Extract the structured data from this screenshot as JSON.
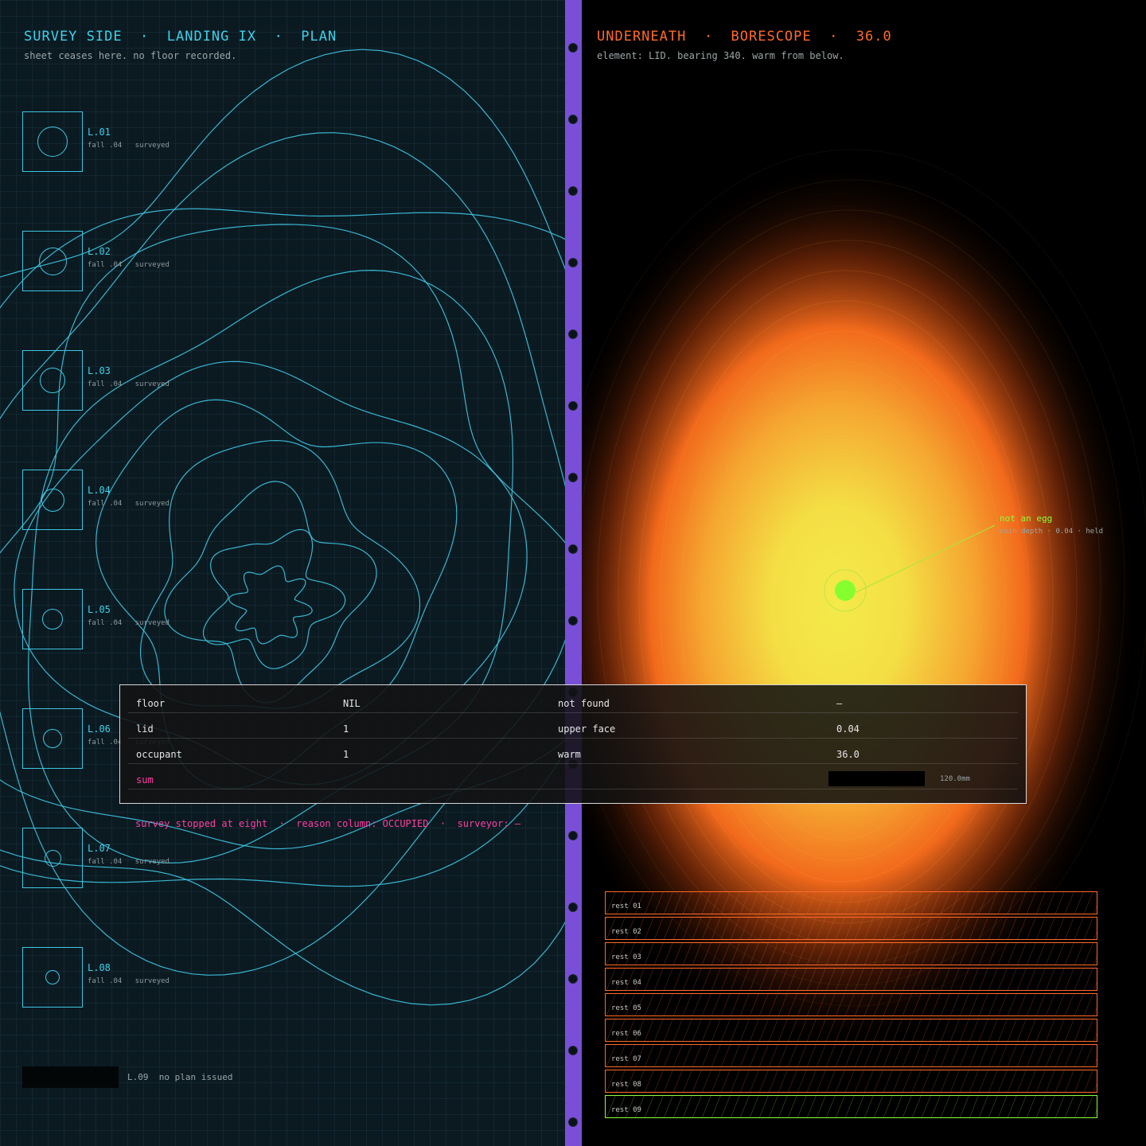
{
  "left": {
    "title": "SURVEY SIDE  ·  LANDING IX  ·  PLAN",
    "subtitle": "sheet ceases here. no floor recorded.",
    "landings": [
      {
        "label": "L.01",
        "detail": "fall .04   surveyed"
      },
      {
        "label": "L.02",
        "detail": "fall .04   surveyed"
      },
      {
        "label": "L.03",
        "detail": "fall .04   surveyed"
      },
      {
        "label": "L.04",
        "detail": "fall .04   surveyed"
      },
      {
        "label": "L.05",
        "detail": "fall .04   surveyed"
      },
      {
        "label": "L.06",
        "detail": "fall .04   surveyed"
      },
      {
        "label": "L.07",
        "detail": "fall .04   surveyed"
      },
      {
        "label": "L.08",
        "detail": "fall .04   surveyed"
      }
    ],
    "l09": "L.09  no plan issued"
  },
  "right": {
    "title": "UNDERNEATH  ·  BORESCOPE  ·  36.0",
    "subtitle": "element: LID. bearing 340. warm from below.",
    "callout_label": "not an egg",
    "callout_detail": "coin depth · 0.04 · held",
    "rests": [
      "rest 01",
      "rest 02",
      "rest 03",
      "rest 04",
      "rest 05",
      "rest 06",
      "rest 07",
      "rest 08",
      "rest 09"
    ]
  },
  "table": {
    "rows": [
      [
        "floor",
        "NIL",
        "not found",
        "—"
      ],
      [
        "lid",
        "1",
        "upper face",
        "0.04"
      ],
      [
        "occupant",
        "1",
        "warm",
        "36.0"
      ]
    ],
    "sum_label": "sum",
    "sum_length": "120.0mm"
  },
  "footer": "survey stopped at eight  ·  reason column: OCCUPIED  ·  surveyor: —",
  "colors": {
    "cyan": "#3fc6e3",
    "orange": "#ff6a2a",
    "magenta": "#ff3fa4",
    "lime": "#8cff3a",
    "spine": "#7a4fd8"
  }
}
